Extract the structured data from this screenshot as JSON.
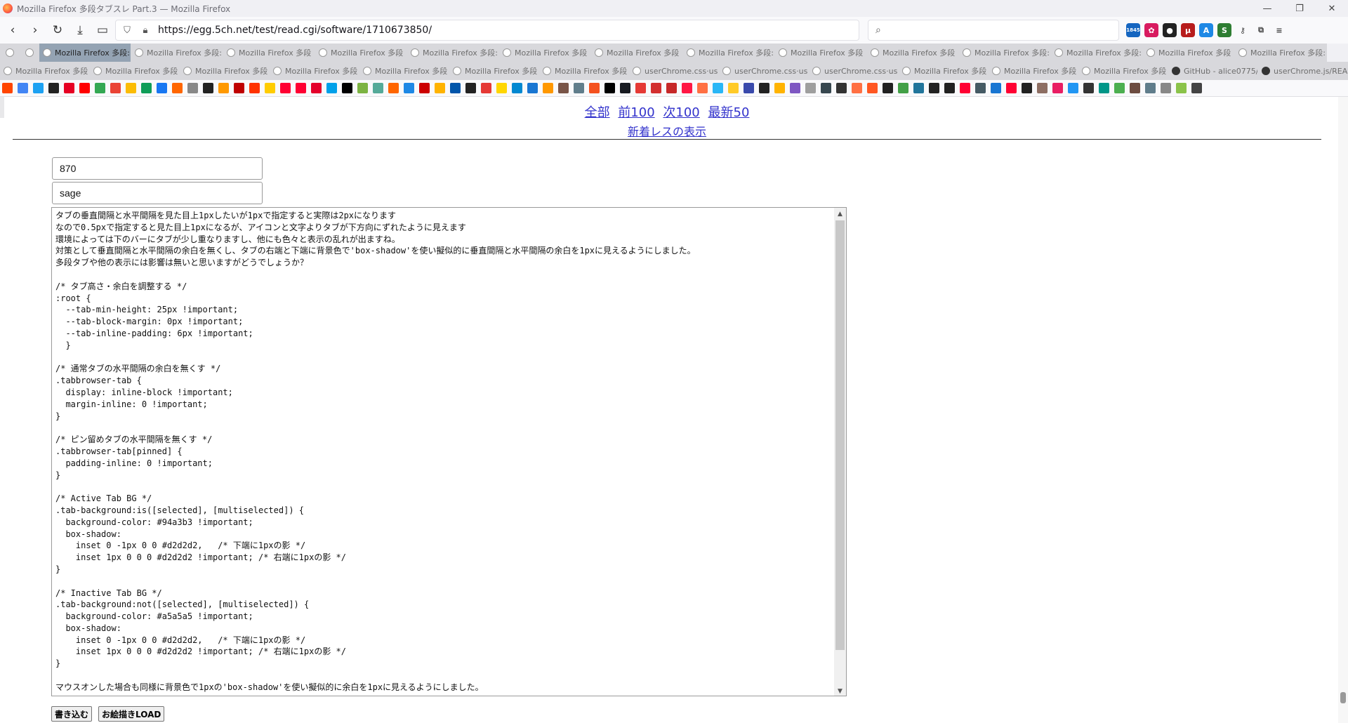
{
  "window": {
    "title": "Mozilla Firefox 多段タブスレ Part.3 — Mozilla Firefox",
    "controls": [
      "—",
      "❐",
      "✕"
    ]
  },
  "navbar": {
    "url": "https://egg.5ch.net/test/read.cgi/software/1710673850/",
    "badge_count": "1845"
  },
  "tabs_row1": [
    {
      "label": "",
      "mini": true
    },
    {
      "label": "",
      "mini": true
    },
    {
      "label": "Mozilla Firefox 多段:",
      "active": true
    },
    {
      "label": "Mozilla Firefox 多段:"
    },
    {
      "label": "Mozilla Firefox 多段"
    },
    {
      "label": "Mozilla Firefox 多段"
    },
    {
      "label": "Mozilla Firefox 多段:"
    },
    {
      "label": "Mozilla Firefox 多段"
    },
    {
      "label": "Mozilla Firefox 多段"
    },
    {
      "label": "Mozilla Firefox 多段:"
    },
    {
      "label": "Mozilla Firefox 多段"
    },
    {
      "label": "Mozilla Firefox 多段"
    },
    {
      "label": "Mozilla Firefox 多段:"
    },
    {
      "label": "Mozilla Firefox 多段:"
    },
    {
      "label": "Mozilla Firefox 多段"
    },
    {
      "label": "Mozilla Firefox 多段:"
    }
  ],
  "tabs_row2": [
    {
      "label": "Mozilla Firefox 多段"
    },
    {
      "label": "Mozilla Firefox 多段"
    },
    {
      "label": "Mozilla Firefox 多段"
    },
    {
      "label": "Mozilla Firefox 多段"
    },
    {
      "label": "Mozilla Firefox 多段"
    },
    {
      "label": "Mozilla Firefox 多段"
    },
    {
      "label": "Mozilla Firefox 多段"
    },
    {
      "label": "userChrome.css·us"
    },
    {
      "label": "userChrome.css·us"
    },
    {
      "label": "userChrome.css·us"
    },
    {
      "label": "Mozilla Firefox 多段"
    },
    {
      "label": "Mozilla Firefox 多段"
    },
    {
      "label": "Mozilla Firefox 多段"
    },
    {
      "label": "GitHub - alice0775/",
      "github": true
    },
    {
      "label": "userChrome.js/REAI",
      "github": true
    }
  ],
  "page": {
    "nav_links": [
      "全部",
      "前100",
      "次100",
      "最新50"
    ],
    "new_res_link": "新着レスの表示",
    "name_field": "870",
    "mail_field": "sage",
    "message": "タブの垂直間隔と水平間隔を見た目上1pxしたいが1pxで指定すると実際は2pxになります\nなので0.5pxで指定すると見た目上1pxになるが、アイコンと文字よりタブが下方向にずれたように見えます\n環境によっては下のバーにタブが少し重なりますし、他にも色々と表示の乱れが出ますね。\n対策として垂直間隔と水平間隔の余白を無くし、タブの右端と下端に背景色で'box-shadow'を使い擬似的に垂直間隔と水平間隔の余白を1pxに見えるようにしました。\n多段タブや他の表示には影響は無いと思いますがどうでしょうか？\n\n/* タブ高さ・余白を調整する */\n:root {\n  --tab-min-height: 25px !important;\n  --tab-block-margin: 0px !important;\n  --tab-inline-padding: 6px !important;\n  }\n\n/* 通常タブの水平間隔の余白を無くす */\n.tabbrowser-tab {\n  display: inline-block !important;\n  margin-inline: 0 !important;\n}\n\n/* ピン留めタブの水平間隔を無くす */\n.tabbrowser-tab[pinned] {\n  padding-inline: 0 !important;\n}\n\n/* Active Tab BG */\n.tab-background:is([selected], [multiselected]) {\n  background-color: #94a3b3 !important;\n  box-shadow:\n    inset 0 -1px 0 0 #d2d2d2,   /* 下端に1pxの影 */\n    inset 1px 0 0 0 #d2d2d2 !important; /* 右端に1pxの影 */\n}\n\n/* Inactive Tab BG */\n.tab-background:not([selected], [multiselected]) {\n  background-color: #a5a5a5 !important;\n  box-shadow:\n    inset 0 -1px 0 0 #d2d2d2,   /* 下端に1pxの影 */\n    inset 1px 0 0 0 #d2d2d2 !important; /* 右端に1pxの影 */\n}\n\nマウスオンした場合も同様に背景色で1pxの'box-shadow'を使い擬似的に余白を1pxに見えるようにしました。",
    "submit_label": "書き込む",
    "oekaki_label": "お絵描きLOAD"
  },
  "bookmark_colors": [
    "#ff4500",
    "#4285f4",
    "#1da1f2",
    "#222",
    "#e60023",
    "#ff0000",
    "#34a853",
    "#ea4335",
    "#fbbc05",
    "#0f9d58",
    "#1877f2",
    "#ff6600",
    "#888",
    "#222",
    "#ff9900",
    "#bf0000",
    "#ff3300",
    "#ffcc00",
    "#ff0033",
    "#ff0033",
    "#e4002b",
    "#00a0e9",
    "#000",
    "#7cb342",
    "#5a9",
    "#ff6600",
    "#1e88e5",
    "#cc0000",
    "#ffb300",
    "#0055aa",
    "#222",
    "#e53935",
    "#ffd600",
    "#0288d1",
    "#1976d2",
    "#ff9800",
    "#795548",
    "#607d8b",
    "#f4511e",
    "#000",
    "#171a21",
    "#e53935",
    "#d32f2f",
    "#c62828",
    "#ff1744",
    "#ff7043",
    "#29b6f6",
    "#ffca28",
    "#3949ab",
    "#222",
    "#ffb300",
    "#7e57c2",
    "#9e9e9e",
    "#37474f",
    "#333",
    "#ff7043",
    "#ff5722",
    "#212121",
    "#43a047",
    "#21759b",
    "#222",
    "#212121",
    "#ff0033",
    "#455a64",
    "#1976d2",
    "#ff0033",
    "#212121",
    "#8d6e63",
    "#e91e63",
    "#2196f3",
    "#333",
    "#009688",
    "#4caf50",
    "#6d4c41",
    "#607d8b",
    "#888",
    "#8bc34a",
    "#444"
  ]
}
